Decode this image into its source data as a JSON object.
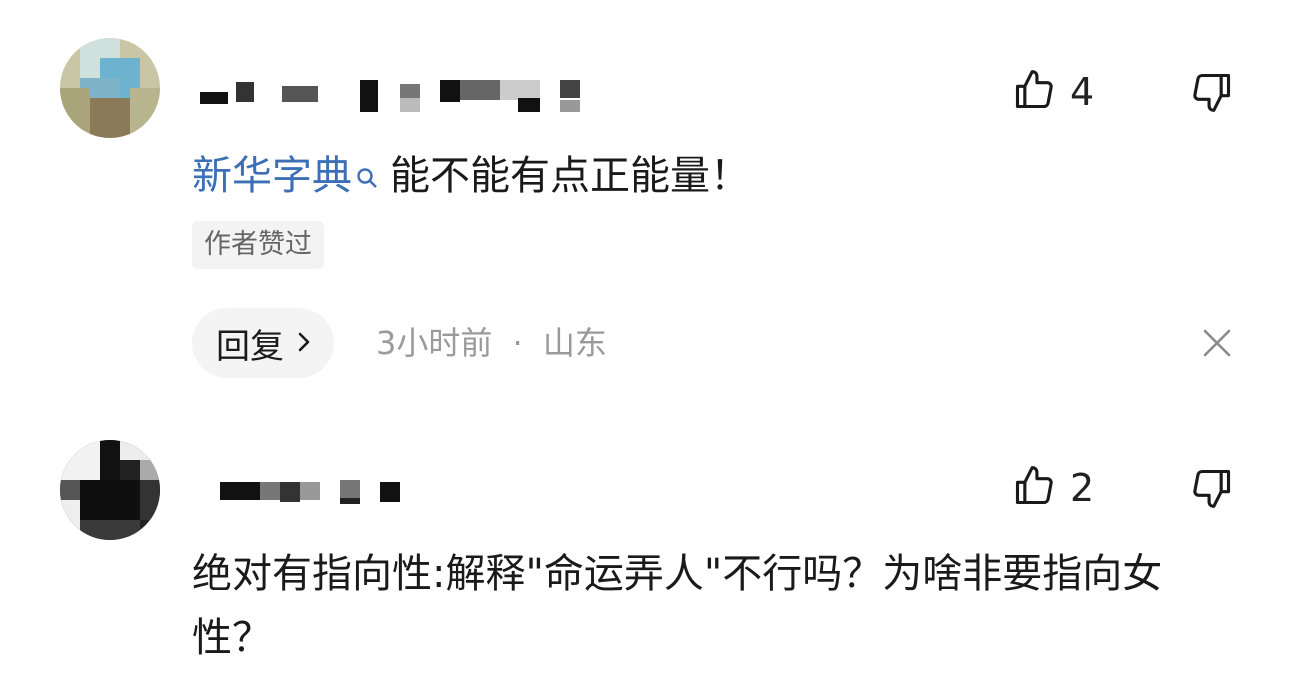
{
  "comments": [
    {
      "likes": "4",
      "content_link": "新华字典",
      "content_text": "能不能有点正能量！",
      "badge": "作者赞过",
      "reply_label": "回复",
      "time": "3小时前",
      "separator": "·",
      "location": "山东"
    },
    {
      "likes": "2",
      "content_text": "绝对有指向性:解释\"命运弄人\"不行吗？为啥非要指向女性？"
    }
  ],
  "icons": {
    "like": "thumbs-up-icon",
    "dislike": "thumbs-down-icon",
    "search": "search-icon",
    "chevron": "chevron-right-icon",
    "close": "close-icon"
  },
  "colors": {
    "link": "#3d6fb6",
    "meta": "#9a9a9a",
    "badge_bg": "#f3f3f3"
  }
}
